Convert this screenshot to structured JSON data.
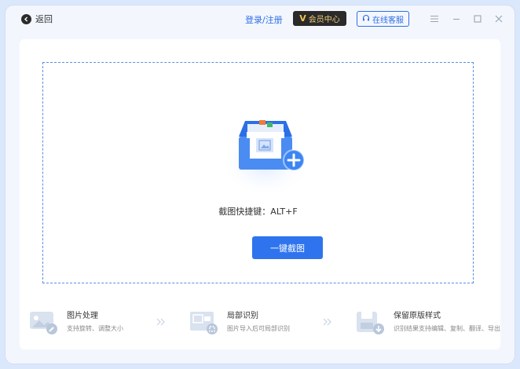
{
  "header": {
    "back_label": "返回",
    "login_label": "登录/注册",
    "vip_label": "会员中心",
    "service_label": "在线客服"
  },
  "dropzone": {
    "shortcut_text": "截图快捷键：ALT+F",
    "capture_button_label": "一键截图"
  },
  "features": [
    {
      "title": "图片处理",
      "desc": "支持旋转、调整大小",
      "icon": "image-edit-icon"
    },
    {
      "title": "局部识别",
      "desc": "图片导入后可局部识别",
      "icon": "crop-recognize-icon"
    },
    {
      "title": "保留原版样式",
      "desc": "识别结果支持编辑、复制、翻译、导出",
      "icon": "save-format-icon"
    }
  ],
  "colors": {
    "accent": "#2f74ee",
    "background": "#dbe8fb",
    "vip_gold": "#f0c878"
  }
}
